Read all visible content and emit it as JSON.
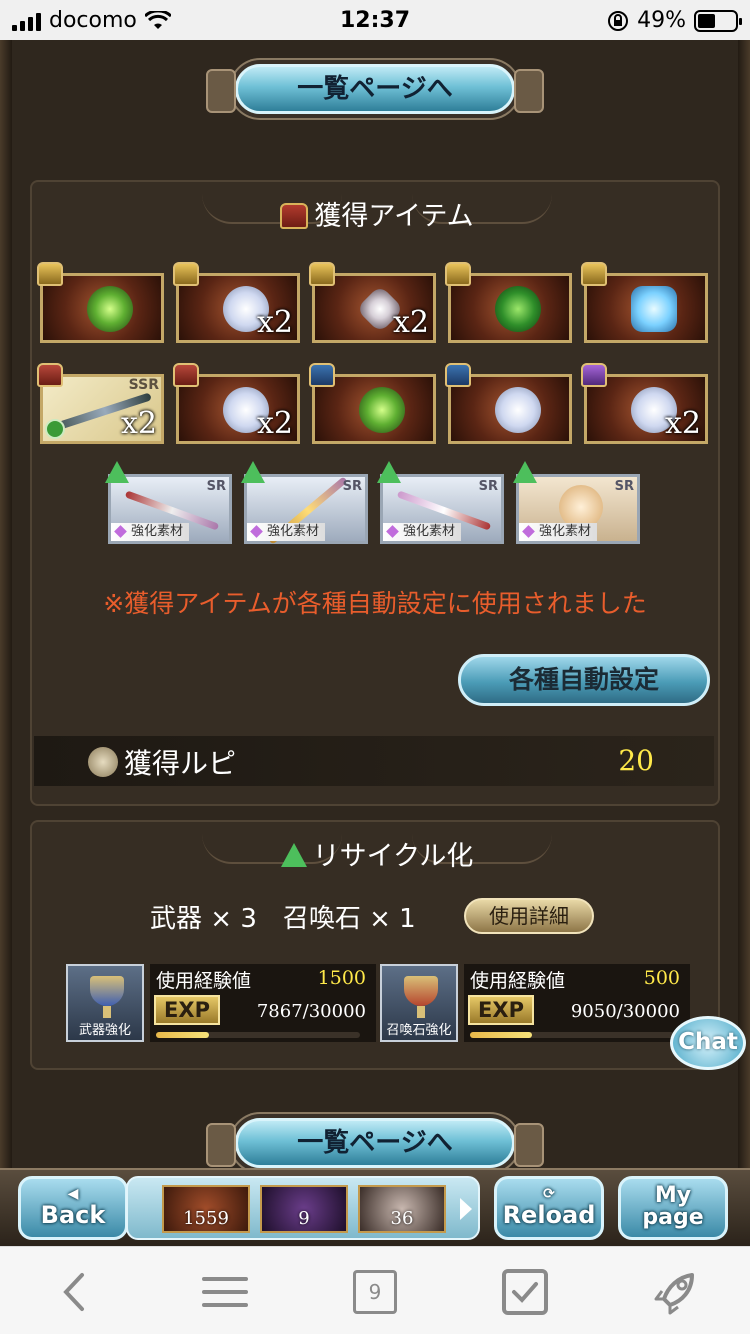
{
  "status": {
    "carrier": "docomo",
    "time": "12:37",
    "battery": "49%"
  },
  "list_button_label": "一覧ページへ",
  "acquired": {
    "title": "獲得アイテム",
    "row1": [
      {
        "kind": "green",
        "count": ""
      },
      {
        "kind": "white",
        "count": "x2"
      },
      {
        "kind": "crystal",
        "count": "x2"
      },
      {
        "kind": "dgreen",
        "count": ""
      },
      {
        "kind": "ice",
        "count": ""
      }
    ],
    "row2": [
      {
        "kind": "weapon",
        "count": "x2",
        "rarity": "SSR"
      },
      {
        "kind": "white",
        "count": "x2"
      },
      {
        "kind": "green",
        "count": ""
      },
      {
        "kind": "white",
        "count": ""
      },
      {
        "kind": "white",
        "count": "x2"
      }
    ],
    "sr_items": [
      {
        "rarity": "SR",
        "tag": "強化素材"
      },
      {
        "rarity": "SR",
        "tag": "強化素材"
      },
      {
        "rarity": "SR",
        "tag": "強化素材"
      },
      {
        "rarity": "SR",
        "tag": "強化素材"
      }
    ],
    "notice": "※獲得アイテムが各種自動設定に使用されました",
    "auto_button": "各種自動設定",
    "rupie_label": "獲得ルピ",
    "rupie_value": "20"
  },
  "recycle": {
    "title": "リサイクル化",
    "summary": "武器 × 3　召喚石 × 1",
    "detail_button": "使用詳細",
    "weapon": {
      "label": "武器強化",
      "exp_title": "使用経験値",
      "exp_value": "1500",
      "exp_badge": "EXP",
      "progress": "7867/30000",
      "fraction": 0.262
    },
    "summon": {
      "label": "召喚石強化",
      "exp_title": "使用経験値",
      "exp_value": "500",
      "exp_badge": "EXP",
      "progress": "9050/30000",
      "fraction": 0.302
    }
  },
  "chat_label": "Chat",
  "game_nav": {
    "back_sub": "◀",
    "back": "Back",
    "quick_items": [
      "1559",
      "9",
      "36"
    ],
    "reload": "Reload",
    "mypage_line1": "My",
    "mypage_line2": "page"
  },
  "browser": {
    "tab_count": "9"
  }
}
